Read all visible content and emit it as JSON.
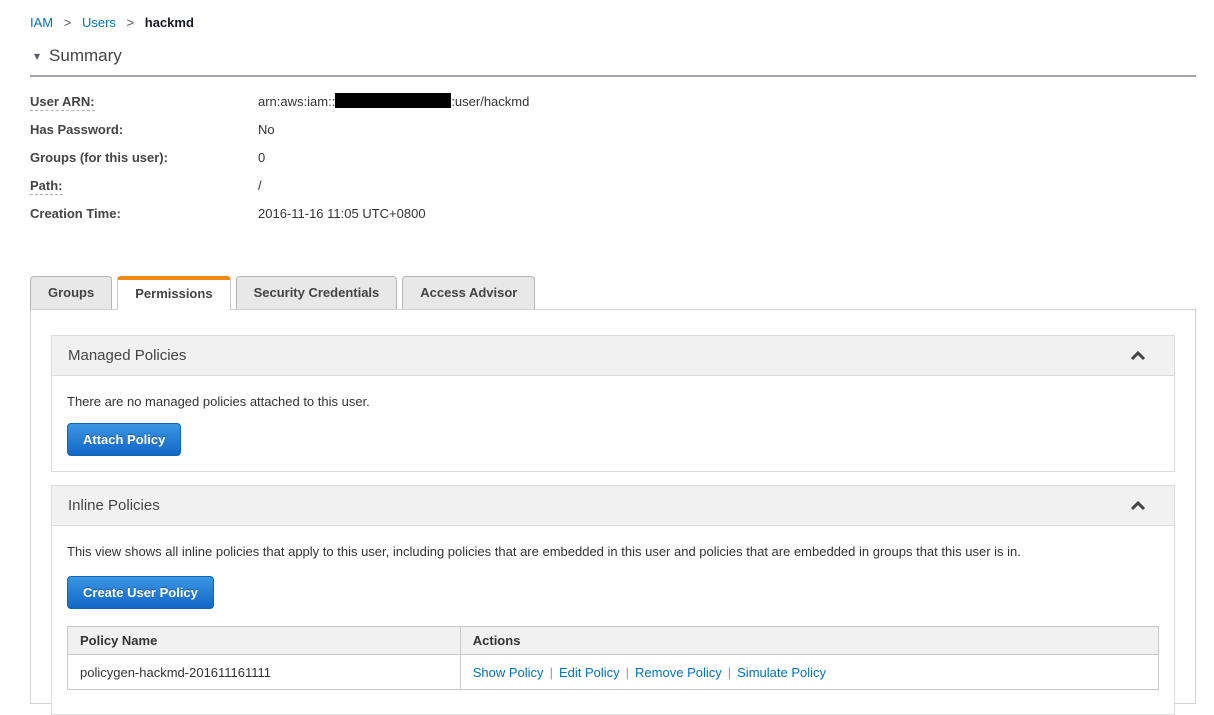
{
  "colors": {
    "link_blue": "#0073bb",
    "tab_active_orange": "#ee8a11",
    "button_blue_top": "#3b96e3",
    "button_blue_bottom": "#1267c6",
    "section_header_gray": "#f1f1f1"
  },
  "breadcrumb": {
    "separator": ">",
    "items": [
      {
        "label": "IAM"
      },
      {
        "label": "Users"
      },
      {
        "label": "hackmd"
      }
    ]
  },
  "summary": {
    "title": "Summary",
    "collapse_icon": "triangle-down",
    "fields": [
      {
        "label": "User ARN:",
        "value_prefix": "arn:aws:iam::",
        "value_redacted": "account-id-hidden",
        "value_suffix": ":user/hackmd"
      },
      {
        "label": "Has Password:",
        "value": "No"
      },
      {
        "label": "Groups (for this user):",
        "value": "0"
      },
      {
        "label": "Path:",
        "value": "/"
      },
      {
        "label": "Creation Time:",
        "value": "2016-11-16 11:05 UTC+0800"
      }
    ]
  },
  "tabs": [
    {
      "label": "Groups",
      "active": false
    },
    {
      "label": "Permissions",
      "active": true
    },
    {
      "label": "Security Credentials",
      "active": false
    },
    {
      "label": "Access Advisor",
      "active": false
    }
  ],
  "managed_policies": {
    "title": "Managed Policies",
    "collapse_icon": "chevron-up",
    "empty_message": "There are no managed policies attached to this user.",
    "attach_button_label": "Attach Policy"
  },
  "inline_policies": {
    "title": "Inline Policies",
    "collapse_icon": "chevron-up",
    "description": "This view shows all inline policies that apply to this user, including policies that are embedded in this user and policies that are embedded in groups that this user is in.",
    "create_button_label": "Create User Policy",
    "table": {
      "columns": [
        "Policy Name",
        "Actions"
      ],
      "rows": [
        {
          "policy_name": "policygen-hackmd-201611161111",
          "actions": [
            "Show Policy",
            "Edit Policy",
            "Remove Policy",
            "Simulate Policy"
          ]
        }
      ]
    }
  }
}
